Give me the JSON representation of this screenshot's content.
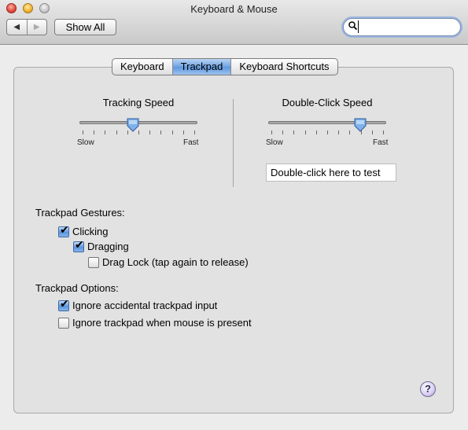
{
  "window": {
    "title": "Keyboard & Mouse"
  },
  "toolbar": {
    "back_glyph": "◀",
    "forward_glyph": "▶",
    "show_all_label": "Show All",
    "search_value": "",
    "search_glyph": "🔍"
  },
  "tabs": [
    {
      "label": "Keyboard",
      "active": false
    },
    {
      "label": "Trackpad",
      "active": true
    },
    {
      "label": "Keyboard Shortcuts",
      "active": false
    }
  ],
  "tracking": {
    "title": "Tracking Speed",
    "min_label": "Slow",
    "max_label": "Fast",
    "value_fraction": 0.45
  },
  "double_click": {
    "title": "Double-Click Speed",
    "min_label": "Slow",
    "max_label": "Fast",
    "value_fraction": 0.78,
    "test_field_text": "Double-click here to test"
  },
  "gestures": {
    "heading": "Trackpad Gestures:",
    "clicking": {
      "label": "Clicking",
      "checked": true
    },
    "dragging": {
      "label": "Dragging",
      "checked": true
    },
    "drag_lock": {
      "label": "Drag Lock (tap again to release)",
      "checked": false
    }
  },
  "options": {
    "heading": "Trackpad Options:",
    "ignore_accidental": {
      "label": "Ignore accidental trackpad input",
      "checked": true
    },
    "ignore_with_mouse": {
      "label": "Ignore trackpad when mouse is present",
      "checked": false
    }
  },
  "help_glyph": "?",
  "colors": {
    "accent": "#5e96dd",
    "window_bg": "#ececec"
  }
}
